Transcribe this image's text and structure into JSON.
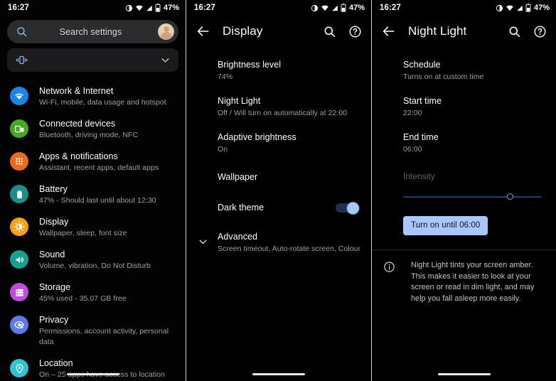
{
  "status_bar": {
    "time": "16:27",
    "battery_percent": "47%",
    "icons": [
      "night-light-icon",
      "wifi-icon",
      "signal-icon",
      "battery-icon"
    ]
  },
  "colors": {
    "accent_blue": "#a9c7fa",
    "background": "#000000",
    "card": "#1b1b1d",
    "search_card": "#2c2c2e",
    "secondary_text": "#9aa0a6"
  },
  "settings_screen": {
    "search": {
      "placeholder": "Search settings",
      "icon": "search-icon",
      "avatar": "account-avatar"
    },
    "vibration_card": {
      "icon": "vibration-icon",
      "expand_icon": "chevron-down-icon"
    },
    "items": [
      {
        "title": "Network & Internet",
        "subtitle": "Wi-Fi, mobile, data usage and hotspot",
        "icon": "wifi-icon",
        "color": "#1a87e8"
      },
      {
        "title": "Connected devices",
        "subtitle": "Bluetooth, driving mode, NFC",
        "icon": "connected-devices-icon",
        "color": "#4aa81f"
      },
      {
        "title": "Apps & notifications",
        "subtitle": "Assistant, recent apps, default apps",
        "icon": "apps-grid-icon",
        "color": "#ec6a1e"
      },
      {
        "title": "Battery",
        "subtitle": "47% - Should last until about 12:30",
        "icon": "battery-icon",
        "color": "#1d8f8a"
      },
      {
        "title": "Display",
        "subtitle": "Wallpaper, sleep, font size",
        "icon": "brightness-icon",
        "color": "#f5a314"
      },
      {
        "title": "Sound",
        "subtitle": "Volume, vibration, Do Not Disturb",
        "icon": "volume-icon",
        "color": "#15a08f"
      },
      {
        "title": "Storage",
        "subtitle": "45% used - 35.07 GB free",
        "icon": "storage-icon",
        "color": "#c14ae0"
      },
      {
        "title": "Privacy",
        "subtitle": "Permissions, account activity, personal data",
        "icon": "privacy-eye-icon",
        "color": "#5b7ce8"
      },
      {
        "title": "Location",
        "subtitle": "On – 25 apps have access to location",
        "icon": "location-pin-icon",
        "color": "#2cc4d8"
      }
    ]
  },
  "display_screen": {
    "title": "Display",
    "back_icon": "back-arrow-icon",
    "actions": [
      "search-icon",
      "help-icon"
    ],
    "items": [
      {
        "title": "Brightness level",
        "subtitle": "74%"
      },
      {
        "title": "Night Light",
        "subtitle": "Off / Will turn on automatically at 22:00"
      },
      {
        "title": "Adaptive brightness",
        "subtitle": "On"
      },
      {
        "title": "Wallpaper",
        "subtitle": ""
      },
      {
        "title": "Dark theme",
        "subtitle": "",
        "toggle": "on"
      },
      {
        "title": "Advanced",
        "subtitle": "Screen timeout, Auto-rotate screen, Colours, Fo..",
        "expand_icon": "chevron-down-icon"
      }
    ]
  },
  "night_light_screen": {
    "title": "Night Light",
    "back_icon": "back-arrow-icon",
    "actions": [
      "search-icon",
      "help-icon"
    ],
    "items": [
      {
        "title": "Schedule",
        "subtitle": "Turns on at custom time"
      },
      {
        "title": "Start time",
        "subtitle": "22:00"
      },
      {
        "title": "End time",
        "subtitle": "06:00"
      }
    ],
    "intensity": {
      "label": "Intensity",
      "value_percent": 77
    },
    "action_button": "Turn on until 06:00",
    "info": {
      "icon": "info-icon",
      "text": "Night Light tints your screen amber. This makes it easier to look at your screen or read in dim light, and may help you fall asleep more easily."
    }
  }
}
